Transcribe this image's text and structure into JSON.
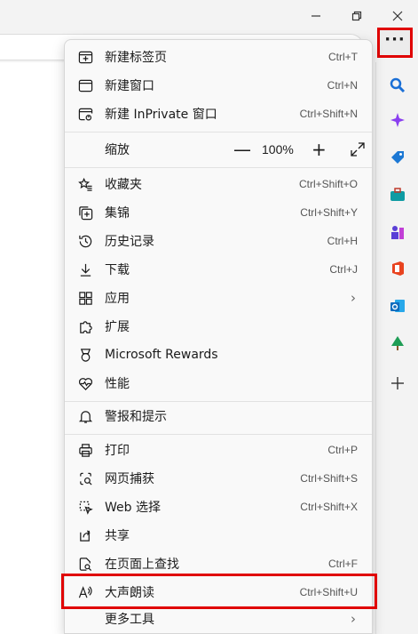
{
  "window": {
    "controls": [
      "minimize-icon",
      "restore-icon",
      "close-icon"
    ]
  },
  "menu": {
    "items_group1": [
      {
        "label": "新建标签页",
        "shortcut": "Ctrl+T",
        "icon": "new-tab-icon"
      },
      {
        "label": "新建窗口",
        "shortcut": "Ctrl+N",
        "icon": "new-window-icon"
      },
      {
        "label": "新建 InPrivate 窗口",
        "shortcut": "Ctrl+Shift+N",
        "icon": "inprivate-icon"
      }
    ],
    "zoom": {
      "label": "缩放",
      "minus": "—",
      "value": "100%",
      "plus": "+"
    },
    "items_group2": [
      {
        "label": "收藏夹",
        "shortcut": "Ctrl+Shift+O",
        "icon": "favorites-icon"
      },
      {
        "label": "集锦",
        "shortcut": "Ctrl+Shift+Y",
        "icon": "collections-icon"
      },
      {
        "label": "历史记录",
        "shortcut": "Ctrl+H",
        "icon": "history-icon"
      },
      {
        "label": "下载",
        "shortcut": "Ctrl+J",
        "icon": "download-icon"
      },
      {
        "label": "应用",
        "shortcut": "",
        "icon": "apps-icon"
      },
      {
        "label": "扩展",
        "shortcut": "",
        "icon": "extensions-icon"
      },
      {
        "label": "Microsoft Rewards",
        "shortcut": "",
        "icon": "rewards-icon"
      },
      {
        "label": "性能",
        "shortcut": "",
        "icon": "performance-icon"
      }
    ],
    "alerts": {
      "label": "警报和提示",
      "icon": "bell-icon"
    },
    "items_group3": [
      {
        "label": "打印",
        "shortcut": "Ctrl+P",
        "icon": "print-icon"
      },
      {
        "label": "网页捕获",
        "shortcut": "Ctrl+Shift+S",
        "icon": "web-capture-icon"
      },
      {
        "label": "Web 选择",
        "shortcut": "Ctrl+Shift+X",
        "icon": "web-select-icon"
      },
      {
        "label": "共享",
        "shortcut": "",
        "icon": "share-icon"
      },
      {
        "label": "在页面上查找",
        "shortcut": "Ctrl+F",
        "icon": "find-icon"
      },
      {
        "label": "大声朗读",
        "shortcut": "Ctrl+Shift+U",
        "icon": "read-aloud-icon"
      },
      {
        "label": "更多工具",
        "shortcut": "",
        "icon": "more-tools-icon"
      }
    ],
    "chevron": "›"
  },
  "sidebar": {
    "more_label": "···",
    "icons": [
      "search-icon",
      "copilot-icon",
      "shopping-icon",
      "tools-icon",
      "games-icon",
      "office-icon",
      "outlook-icon",
      "tree-icon",
      "add-icon"
    ],
    "colors": {
      "search": "#1a6fd6",
      "copilot": "#8a3ff0",
      "shopping": "#1c78d4",
      "tools": "#0f9ba3",
      "games": "#5a3fd6",
      "office": "#e8431f",
      "outlook": "#0f6cbd",
      "tree": "#1f9d55"
    }
  },
  "highlight_color": "#e00000"
}
